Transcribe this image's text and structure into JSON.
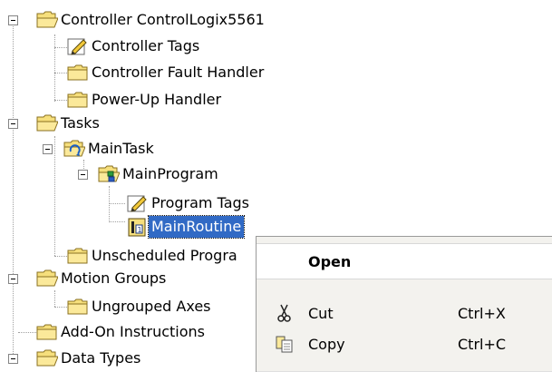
{
  "tree": {
    "controller": "Controller ControlLogix5561",
    "controller_tags": "Controller Tags",
    "fault_handler": "Controller Fault Handler",
    "powerup_handler": "Power-Up Handler",
    "tasks": "Tasks",
    "main_task": "MainTask",
    "main_program": "MainProgram",
    "program_tags": "Program Tags",
    "main_routine": "MainRoutine",
    "unscheduled": "Unscheduled Progra",
    "motion_groups": "Motion Groups",
    "ungrouped_axes": "Ungrouped Axes",
    "addon": "Add-On Instructions",
    "data_types": "Data Types"
  },
  "context_menu": {
    "open": "Open",
    "cut": "Cut",
    "cut_shortcut": "Ctrl+X",
    "copy": "Copy",
    "copy_shortcut": "Ctrl+C"
  },
  "icons": {
    "folder": "folder-icon",
    "tags": "tags-pencil-icon",
    "task": "task-cycle-icon",
    "program": "program-icon",
    "routine": "ladder-routine-icon",
    "cut": "scissors-icon",
    "copy": "copy-icon"
  },
  "colors": {
    "selection": "#316ac5",
    "folder_fill": "#f6df7c",
    "menu_bg": "#f3f2ee"
  }
}
